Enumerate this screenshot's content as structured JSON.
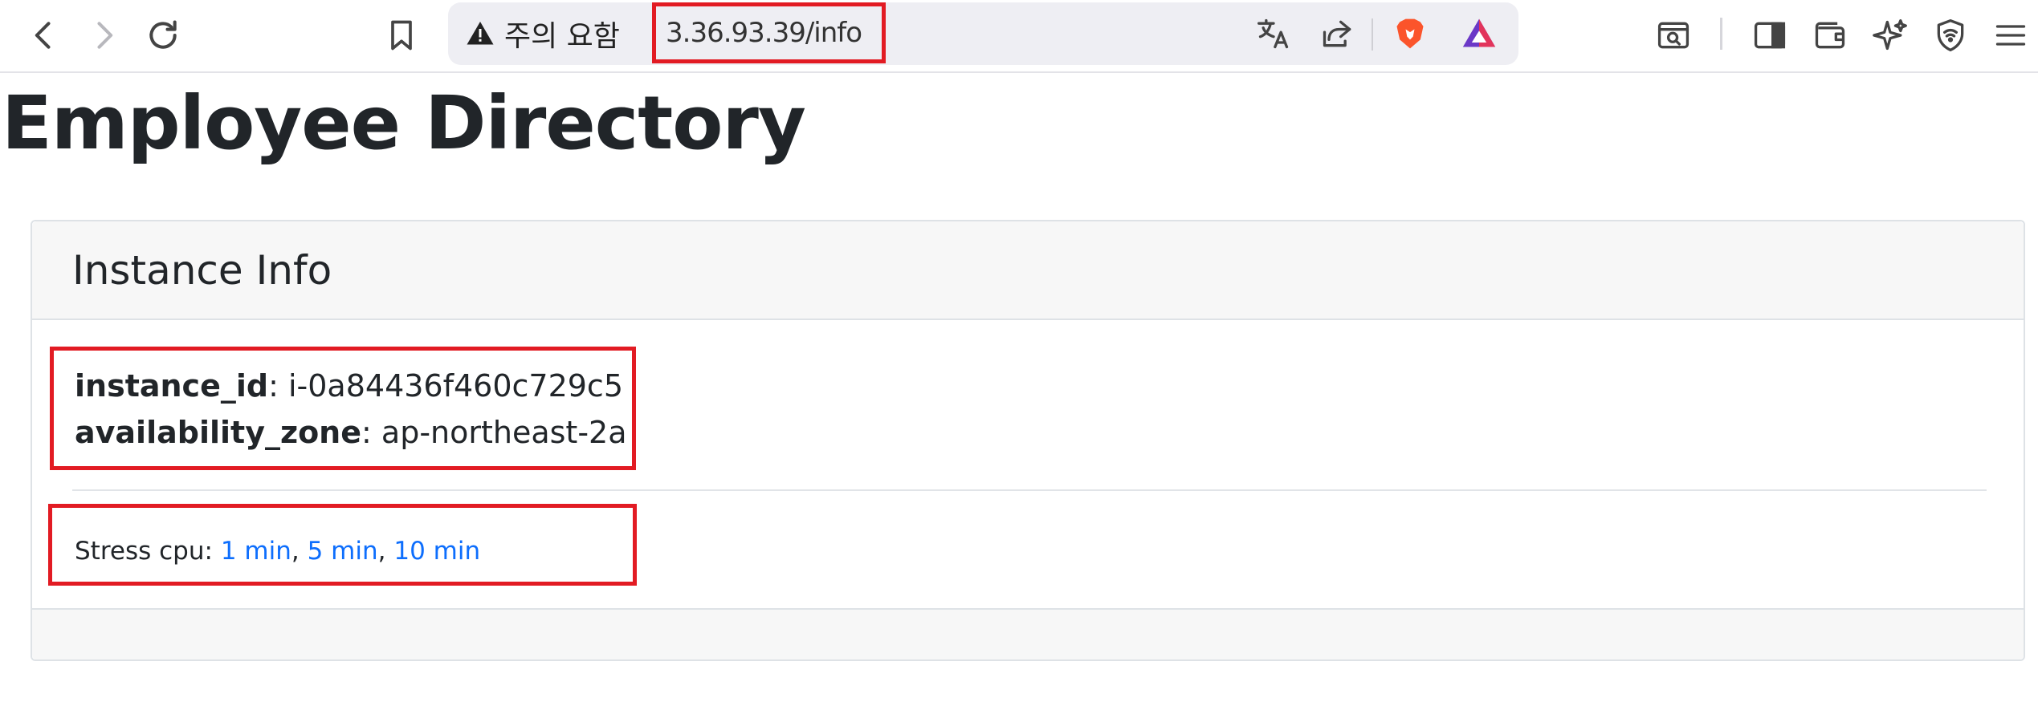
{
  "browser": {
    "security_warning": "주의 요함",
    "url": "3.36.93.39/info"
  },
  "page": {
    "title": "Employee Directory"
  },
  "card": {
    "title": "Instance Info",
    "fields": [
      {
        "key": "instance_id",
        "value": "i-0a84436f460c729c5"
      },
      {
        "key": "availability_zone",
        "value": "ap-northeast-2a"
      }
    ],
    "stress": {
      "label": "Stress cpu:",
      "links": [
        "1 min",
        "5 min",
        "10 min"
      ],
      "separator": ","
    }
  },
  "colors": {
    "highlight": "#e21b23",
    "link": "#0d6efd",
    "text": "#212529"
  }
}
